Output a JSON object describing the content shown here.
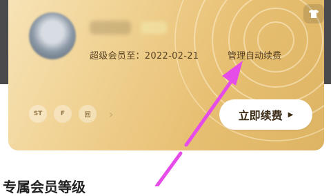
{
  "membership_card": {
    "expiry_text": "超级会员至：2022-02-21",
    "manage_auto_renew": "管理自动续费",
    "renew_button": "立即续费",
    "renew_arrow": "▶",
    "benefits": [
      "ST",
      "F",
      "回"
    ],
    "benefits_more": "›"
  },
  "section": {
    "title": "专属会员等级"
  },
  "icons": {
    "top_right": "t-shirt-icon",
    "annotation": "arrow-icon"
  },
  "colors": {
    "card_gold": "#e7bf72",
    "annotation_arrow": "#e54ce8",
    "header_dark": "#4a4a4c"
  }
}
